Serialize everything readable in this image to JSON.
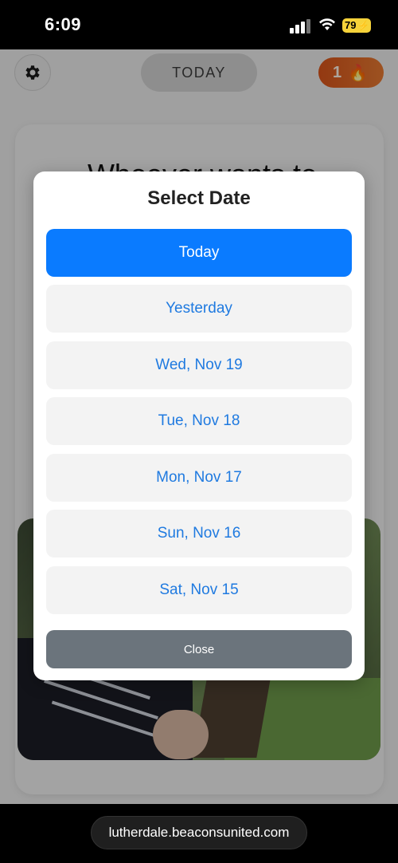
{
  "status_bar": {
    "time": "6:09",
    "battery": "79",
    "battery_color": "#f7d33a"
  },
  "header": {
    "settings_icon": "gear-icon",
    "today_label": "TODAY",
    "streak_count": "1",
    "streak_icon": "flame-icon",
    "streak_color": "#e0612a"
  },
  "card": {
    "prompt_text": "Whoever wants to"
  },
  "modal": {
    "title": "Select Date",
    "options": [
      {
        "label": "Today",
        "selected": true
      },
      {
        "label": "Yesterday",
        "selected": false
      },
      {
        "label": "Wed, Nov 19",
        "selected": false
      },
      {
        "label": "Tue, Nov 18",
        "selected": false
      },
      {
        "label": "Mon, Nov 17",
        "selected": false
      },
      {
        "label": "Sun, Nov 16",
        "selected": false
      },
      {
        "label": "Sat, Nov 15",
        "selected": false
      }
    ],
    "close_label": "Close",
    "accent_color": "#0a7bff",
    "option_text_color": "#1f7ae0"
  },
  "browser": {
    "url": "lutherdale.beaconsunited.com"
  }
}
